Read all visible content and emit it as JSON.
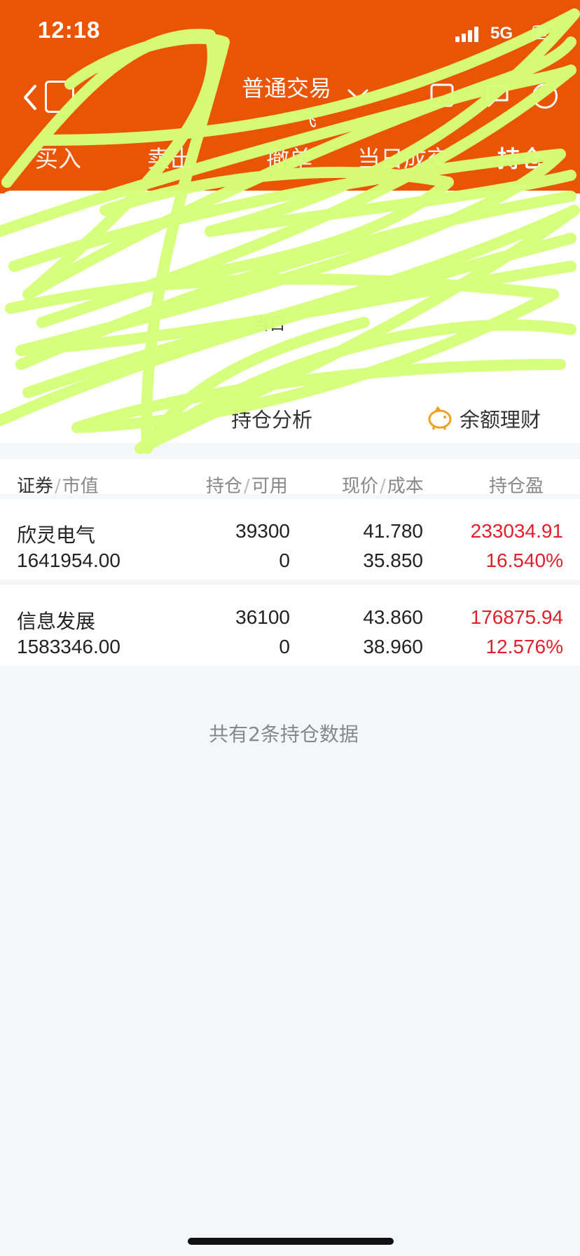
{
  "status_bar": {
    "time": "12:18",
    "network": "5G"
  },
  "topbar": {
    "title": "普通交易",
    "account": "**飞"
  },
  "tabs": [
    {
      "label": "买入"
    },
    {
      "label": "卖出"
    },
    {
      "label": "撤单"
    },
    {
      "label": "当日成交"
    },
    {
      "label": "持仓"
    }
  ],
  "summary": {
    "label_today": "当日"
  },
  "actions": [
    {
      "label": "持仓分析",
      "icon": "chart-icon"
    },
    {
      "label": "余额理财",
      "icon": "piggy-bank-icon"
    }
  ],
  "table_header": {
    "col1_main": "证券",
    "col1_sub": "市值",
    "col2_main": "持仓",
    "col2_sub": "可用",
    "col3_main": "现价",
    "col3_sub": "成本",
    "col4_main": "持仓盈"
  },
  "positions": [
    {
      "name": "欣灵电气",
      "market_value": "1641954.00",
      "holding": "39300",
      "available": "0",
      "price": "41.780",
      "cost": "35.850",
      "profit": "233034.91",
      "profit_pct": "16.540%"
    },
    {
      "name": "信息发展",
      "market_value": "1583346.00",
      "holding": "36100",
      "available": "0",
      "price": "43.860",
      "cost": "38.960",
      "profit": "176875.94",
      "profit_pct": "12.576%"
    }
  ],
  "footer_note": "共有2条持仓数据",
  "colors": {
    "brand": "#ea5505",
    "profit": "#e0202a",
    "scribble": "#d6ff7a"
  }
}
